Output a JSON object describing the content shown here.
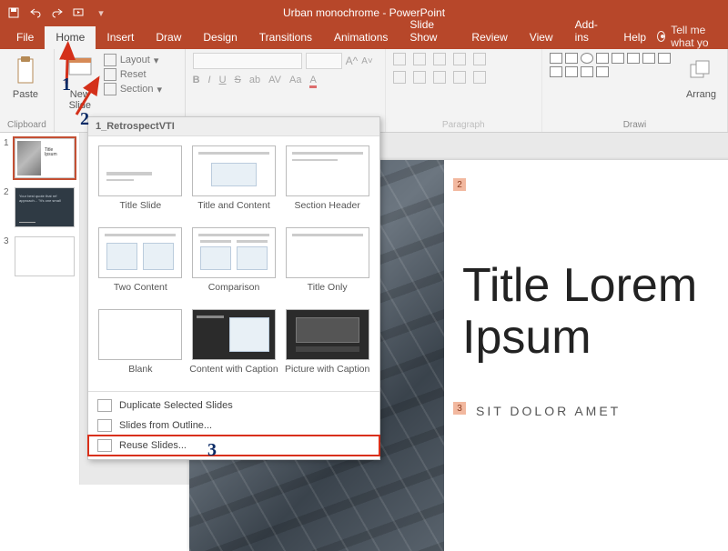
{
  "app": {
    "title": "Urban monochrome  -  PowerPoint"
  },
  "qat_icons": [
    "save-icon",
    "undo-icon",
    "redo-icon",
    "start-slideshow-icon"
  ],
  "tabs": [
    "File",
    "Home",
    "Insert",
    "Draw",
    "Design",
    "Transitions",
    "Animations",
    "Slide Show",
    "Review",
    "View",
    "Add-ins",
    "Help"
  ],
  "active_tab": "Home",
  "tellme": "Tell me what yo",
  "ribbon": {
    "clipboard": {
      "paste": "Paste",
      "label": "Clipboard"
    },
    "slides": {
      "new_slide": "New\nSlide",
      "layout": "Layout",
      "reset": "Reset",
      "section": "Section"
    },
    "font": {
      "buttons": [
        "B",
        "I",
        "U",
        "S",
        "ab",
        "AV",
        "Aa",
        "A"
      ]
    },
    "paragraph": {
      "label": "Paragraph"
    },
    "drawing": {
      "arrange": "Arrang",
      "label": "Drawi"
    }
  },
  "gallery": {
    "theme": "1_RetrospectVTI",
    "layouts": [
      "Title Slide",
      "Title and Content",
      "Section Header",
      "Two Content",
      "Comparison",
      "Title Only",
      "Blank",
      "Content with Caption",
      "Picture with Caption"
    ],
    "menu": {
      "duplicate": "Duplicate Selected Slides",
      "outline": "Slides from Outline...",
      "reuse": "Reuse Slides..."
    }
  },
  "thumbs": [
    "1",
    "2",
    "3"
  ],
  "slide": {
    "title_line1": "Title Lorem",
    "title_line2": "Ipsum",
    "subtitle": "SIT DOLOR AMET",
    "tag_top": "2",
    "tag_sub": "3"
  },
  "annotations": {
    "n1": "1",
    "n2": "2",
    "n3": "3"
  }
}
